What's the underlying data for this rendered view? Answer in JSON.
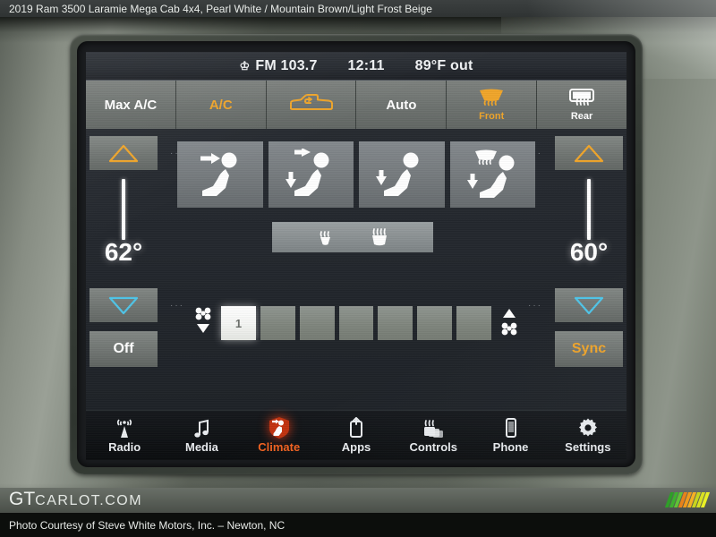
{
  "caption": {
    "top": "2019 Ram 3500 Laramie Mega Cab 4x4,  Pearl White / Mountain Brown/Light Frost Beige",
    "bottom": "Photo Courtesy of Steve White Motors, Inc. – Newton, NC"
  },
  "watermark": {
    "logo_bold": "GT",
    "logo_rest": "CARLOT.COM",
    "stripe_colors": [
      "#2f9e28",
      "#3fb02f",
      "#5fc235",
      "#e8821a",
      "#f09a1c",
      "#f5b024",
      "#c8d41e",
      "#d9e022",
      "#e8ef26"
    ]
  },
  "statusbar": {
    "antenna_icon": "antenna-icon",
    "radio_band": "FM 103.7",
    "clock": "12:11",
    "outside_temp": "89°F out"
  },
  "top_buttons": [
    {
      "label": "Max A/C",
      "sub": "",
      "icon": "",
      "color": "white",
      "active": false
    },
    {
      "label": "A/C",
      "sub": "",
      "icon": "",
      "color": "amber",
      "active": true
    },
    {
      "label": "",
      "sub": "",
      "icon": "recirculation-truck-icon",
      "color": "amber",
      "active": true
    },
    {
      "label": "Auto",
      "sub": "",
      "icon": "",
      "color": "white",
      "active": false
    },
    {
      "label": "",
      "sub": "Front",
      "icon": "front-defrost-icon",
      "color": "amber",
      "active": true
    },
    {
      "label": "",
      "sub": "Rear",
      "icon": "rear-defrost-icon",
      "color": "white",
      "active": false
    }
  ],
  "temperature": {
    "left": {
      "value": "62°",
      "up_icon": "triangle-up-icon",
      "down_icon": "triangle-down-icon",
      "up_color": "#f0a52a",
      "down_color": "#4fc5e8",
      "bottom_button": "Off",
      "bottom_button_color": "white"
    },
    "right": {
      "value": "60°",
      "up_icon": "triangle-up-icon",
      "down_icon": "triangle-down-icon",
      "up_color": "#f0a52a",
      "down_color": "#4fc5e8",
      "bottom_button": "Sync",
      "bottom_button_color": "amber"
    }
  },
  "airflow_modes": [
    {
      "name": "mode-face-icon",
      "label": "Face"
    },
    {
      "name": "mode-face-feet-icon",
      "label": "Face and Feet"
    },
    {
      "name": "mode-feet-icon",
      "label": "Feet"
    },
    {
      "name": "mode-defrost-feet-icon",
      "label": "Defrost and Feet"
    }
  ],
  "heated_row": [
    {
      "name": "heated-steering-wheel-icon",
      "label": "Heated Steering Wheel"
    },
    {
      "name": "heated-seat-icon",
      "label": "Heated Seat"
    }
  ],
  "fan": {
    "decrease_icon": "fan-decrease-icon",
    "increase_icon": "fan-increase-icon",
    "level": 1,
    "max_level": 7,
    "segments": [
      "1",
      "",
      "",
      "",
      "",
      "",
      ""
    ]
  },
  "nav": [
    {
      "label": "Radio",
      "icon": "radio-tower-icon",
      "active": false
    },
    {
      "label": "Media",
      "icon": "music-note-icon",
      "active": false
    },
    {
      "label": "Climate",
      "icon": "climate-seat-icon",
      "active": true
    },
    {
      "label": "Apps",
      "icon": "apps-icon",
      "active": false
    },
    {
      "label": "Controls",
      "icon": "controls-icon",
      "active": false
    },
    {
      "label": "Phone",
      "icon": "phone-icon",
      "active": false
    },
    {
      "label": "Settings",
      "icon": "gear-icon",
      "active": false
    }
  ],
  "colors": {
    "amber": "#f0a52a",
    "cyan": "#4fc5e8",
    "active_orange": "#f4621f",
    "white": "#ffffff"
  }
}
